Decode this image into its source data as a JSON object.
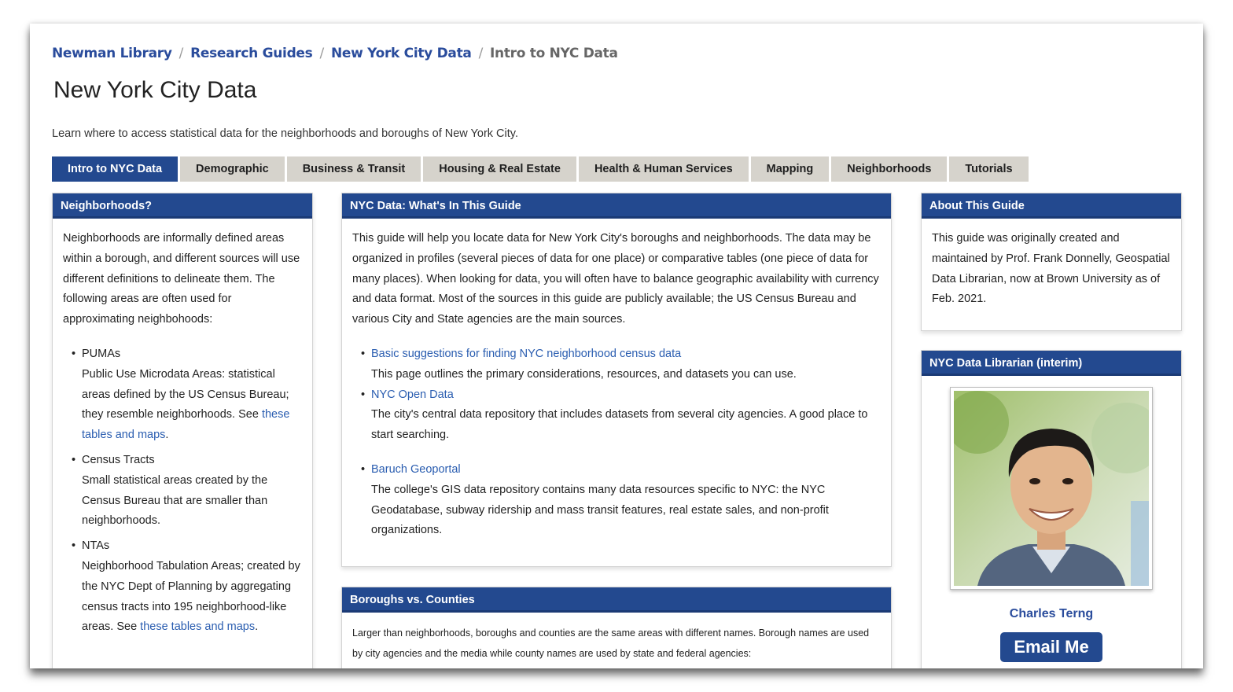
{
  "breadcrumb": {
    "items": [
      "Newman Library",
      "Research Guides",
      "New York City Data"
    ],
    "current": "Intro to NYC Data"
  },
  "page": {
    "title": "New York City Data",
    "description": "Learn where to access statistical data for the neighborhoods and boroughs of New York City."
  },
  "tabs": [
    "Intro to NYC Data",
    "Demographic",
    "Business & Transit",
    "Housing & Real Estate",
    "Health & Human Services",
    "Mapping",
    "Neighborhoods",
    "Tutorials"
  ],
  "neighborhoods_box": {
    "title": "Neighborhoods?",
    "intro": "Neighborhoods are informally defined areas within a borough, and different sources will use different definitions to delineate them. The following areas are often used for approximating neighbohoods:",
    "items": [
      {
        "term": "PUMAs",
        "text": "Public Use Microdata Areas: statistical areas defined by the US Census Bureau; they resemble neighborhoods. See ",
        "link": "these tables and maps",
        "after": "."
      },
      {
        "term": "Census Tracts",
        "text": "Small statistical areas created by the Census Bureau that are smaller than neighborhoods.",
        "link": "",
        "after": ""
      },
      {
        "term": "NTAs",
        "text": "Neighborhood Tabulation Areas; created by the NYC Dept of Planning by aggregating census tracts into 195 neighborhood-like areas. See ",
        "link": "these tables and maps",
        "after": "."
      }
    ]
  },
  "guide_box": {
    "title": "NYC Data: What's In This Guide",
    "intro": "This guide will help you locate data for New York City's boroughs and neighborhoods. The data may be organized in profiles (several pieces of data for one place) or comparative tables (one piece of data for many places). When looking for data, you will often have to balance geographic availability with currency and data format. Most of the sources in this guide are publicly available; the US Census Bureau and various City and State agencies are the main sources.",
    "links": [
      {
        "label": "Basic suggestions for finding NYC neighborhood census data",
        "desc": "This page outlines the primary considerations, resources, and datasets you can use."
      },
      {
        "label": "NYC Open Data",
        "desc": "The city's central data repository that includes datasets from several city agencies. A good place to start searching."
      },
      {
        "label": "Baruch Geoportal",
        "desc": "The college's GIS data repository contains many data resources specific to NYC: the NYC Geodatabase, subway ridership and mass transit features, real estate sales, and non-profit organizations."
      }
    ]
  },
  "boroughs_box": {
    "title": "Boroughs vs. Counties",
    "text": "Larger than neighborhoods, boroughs and counties are the same areas with different names. Borough names are used by city agencies and the media while county names are used by state and federal agencies:"
  },
  "about_box": {
    "title": "About This Guide",
    "text": "This guide was originally created and maintained by Prof. Frank Donnelly, Geospatial Data Librarian, now at Brown University as of Feb. 2021."
  },
  "librarian_box": {
    "title": "NYC Data Librarian (interim)",
    "name": "Charles Terng",
    "button": "Email Me"
  },
  "colors": {
    "brand_blue": "#23498f",
    "tab_gray": "#d6d3cc",
    "link_blue": "#2a5db0"
  }
}
